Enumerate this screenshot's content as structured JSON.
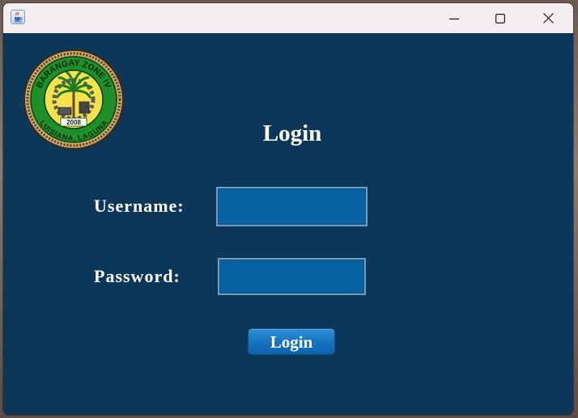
{
  "window": {
    "title": "",
    "titlebar_color": "#f3eff0",
    "background_color": "#0c3759",
    "app_icon": "java-cup-icon",
    "controls": {
      "minimize_icon": "minimize-icon",
      "maximize_icon": "maximize-icon",
      "close_icon": "close-icon"
    }
  },
  "logo": {
    "name": "barangay-seal-logo",
    "top_text": "BARANGAY ZONE IV",
    "bottom_text": "LUISIANA, LAGUNA",
    "year": "2008",
    "ring_color": "#1f8f2a",
    "inner_color": "#f3e24a"
  },
  "form": {
    "heading": "Login",
    "username_label": "Username:",
    "username_value": "",
    "password_label": "Password:",
    "password_value": "",
    "login_button_label": "Login",
    "field_color": "#0862a2",
    "button_color": "#1673bf"
  }
}
